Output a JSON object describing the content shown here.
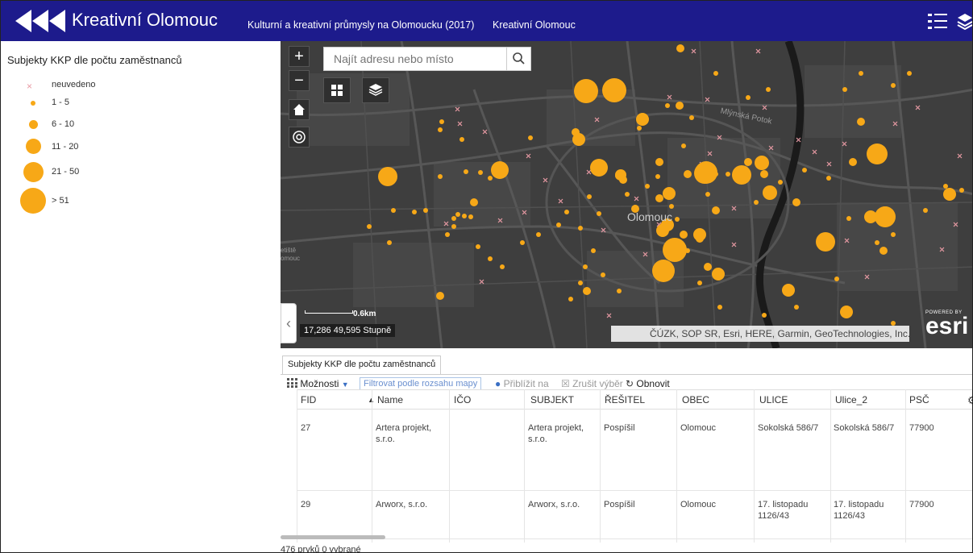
{
  "header": {
    "app_title": "Kreativní Olomouc",
    "subtitle": "Kulturní a kreativní průmysly na Olomoucku (2017)",
    "link": "Kreativní Olomouc",
    "icons": [
      "back-arrows-logo",
      "legend-list-icon",
      "layers-icon"
    ],
    "background": "#1d1b8c"
  },
  "legend": {
    "title": "Subjekty KKP dle počtu zaměstnanců",
    "items": [
      {
        "label": "neuvedeno",
        "symbol": "cross"
      },
      {
        "label": "1 - 5",
        "symbol": "circle"
      },
      {
        "label": "6 - 10",
        "symbol": "circle"
      },
      {
        "label": "11 - 20",
        "symbol": "circle"
      },
      {
        "label": "21 - 50",
        "symbol": "circle"
      },
      {
        "label": "> 51",
        "symbol": "circle"
      }
    ],
    "symbol_color": "#f7a817",
    "cross_color": "#e89aa4"
  },
  "map": {
    "zoom_in": "+",
    "zoom_out": "−",
    "search_placeholder": "Najít adresu nebo místo",
    "scale_label": "0.6km",
    "coordinates": "17,286 49,595 Stupně",
    "attribution": "ČÚZK, SOP SR, Esri, HERE, Garmin, GeoTechnologies, Inc., USG...",
    "city_label": "Olomouc",
    "street_label": "Mlýnská Potok",
    "left_labels": [
      "etiště",
      "omouc"
    ],
    "esri_small": "POWERED BY",
    "esri_big": "esri"
  },
  "table": {
    "tab_label": "Subjekty KKP dle počtu zaměstnanců",
    "toolbar": {
      "options": "Možnosti",
      "filter": "Filtrovat podle rozsahu mapy",
      "zoom_to": "Přiblížit na",
      "clear": "Zrušit výběr",
      "refresh": "Obnovit"
    },
    "columns": [
      "FID",
      "Name",
      "IČO",
      "SUBJEKT",
      "ŘEŠITEL",
      "OBEC",
      "ULICE",
      "Ulice_2",
      "PSČ"
    ],
    "rows": [
      {
        "fid": "27",
        "name": "Artera projekt, s.r.o.",
        "ico": "",
        "subjekt": "Artera projekt, s.r.o.",
        "resitel": "Pospíšil",
        "obec": "Olomouc",
        "ulice": "Sokolská 586/7",
        "ulice2": "Sokolská 586/7",
        "psc": "77900"
      },
      {
        "fid": "29",
        "name": "Arworx, s.r.o.",
        "ico": "",
        "subjekt": "Arworx, s.r.o.",
        "resitel": "Pospíšil",
        "obec": "Olomouc",
        "ulice": "17. listopadu 1126/43",
        "ulice2": "17. listopadu 1126/43",
        "psc": "77900"
      }
    ],
    "footer": "476 prvků 0 vybrané"
  }
}
